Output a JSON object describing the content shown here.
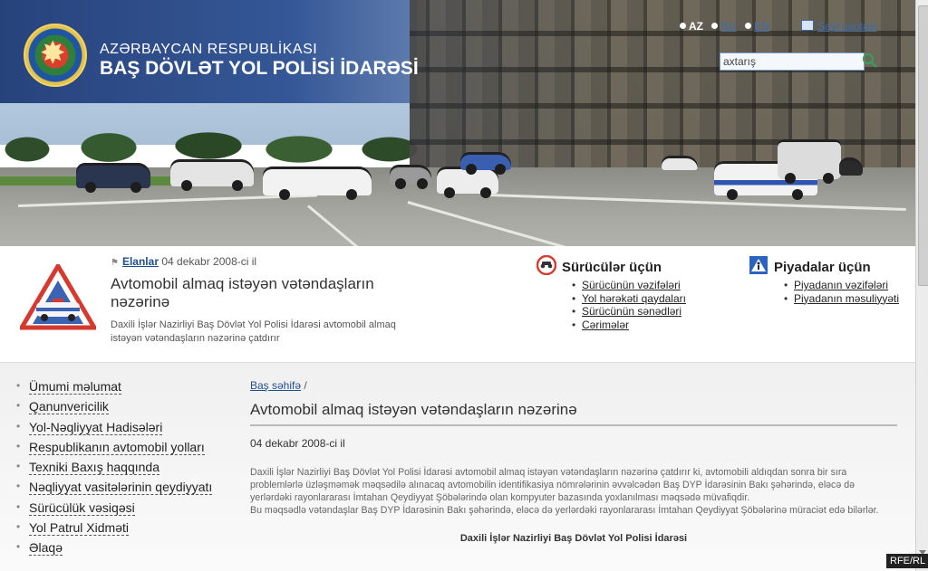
{
  "header": {
    "republic_label": "AZƏRBAYCAN RESPUBLİKASI",
    "agency_name": "BAŞ DÖVLƏT YOL POLİSİ İDARƏSİ",
    "languages": [
      {
        "code": "AZ",
        "active": true
      },
      {
        "code": "RU",
        "active": false
      },
      {
        "code": "EN",
        "active": false
      }
    ],
    "sitemap_label": "Sayt xəritəsi",
    "search_value": "axtarış"
  },
  "news": {
    "category": "Elanlar",
    "date": "04 dekabr 2008-ci il",
    "title": "Avtomobil almaq istəyən vətəndaşların nəzərinə",
    "description": "Daxili İşlər Nazirliyi Baş Dövlət Yol Polisi İdarəsi avtomobil almaq istəyən vətəndaşların nəzərinə çatdırır"
  },
  "drivers": {
    "title": "Sürücülər üçün",
    "links": [
      "Sürücünün vəzifələri",
      "Yol hərəkəti qaydaları",
      "Sürücünün sənədləri",
      "Cərimələr"
    ]
  },
  "pedestrians": {
    "title": "Piyadalar üçün",
    "links": [
      "Piyadanın vəzifələri",
      "Piyadanın məsuliyyəti"
    ]
  },
  "sidebar": {
    "items": [
      "Ümumi məlumat",
      "Qanunvericilik",
      "Yol-Nəqliyyat Hadisələri",
      "Respublikanın avtomobil yolları",
      "Texniki Baxış haqqında",
      "Nəqliyyat vasitələrinin qeydiyyatı",
      "Sürücülük vəsiqəsi",
      "Yol Patrul Xidməti",
      "Əlaqə"
    ]
  },
  "article": {
    "breadcrumb_home": "Baş səhifə",
    "breadcrumb_sep": "/",
    "title": "Avtomobil almaq istəyən vətəndaşların nəzərinə",
    "date": "04 dekabr 2008-ci il",
    "body_1": "Daxili İşlər Nazirliyi Baş Dövlət Yol Polisi İdarəsi avtomobil almaq istəyən vətəndaşların nəzərinə çatdırır ki, avtomobili aldıqdan sonra bir sıra problemlərlə üzləşməmək məqsədilə alınacaq avtomobilin identifikasiya nömrələrinin əvvəlcədən Baş DYP İdarəsinin Bakı şəhərində, eləcə də yerlərdəki rayonlararası İmtahan Qeydiyyat Şöbələrində olan kompyuter bazasında yoxlanılması məqsədə müvafiqdir.",
    "body_2": "Bu məqsədlə vətəndaşlar Baş DYP İdarəsinin Bakı şəhərində, eləcə də yerlərdəki rayonlararası İmtahan Qeydiyyat Şöbələrinə müraciət edə bilərlər.",
    "signature": "Daxili İşlər Nazirliyi Baş Dövlət Yol Polisi İdarəsi"
  },
  "watermark": "RFE/RL",
  "colors": {
    "navy": "#27437c",
    "link": "#1f4e8c",
    "police_red": "#d63a2f",
    "sign_blue": "#2a64c0"
  }
}
